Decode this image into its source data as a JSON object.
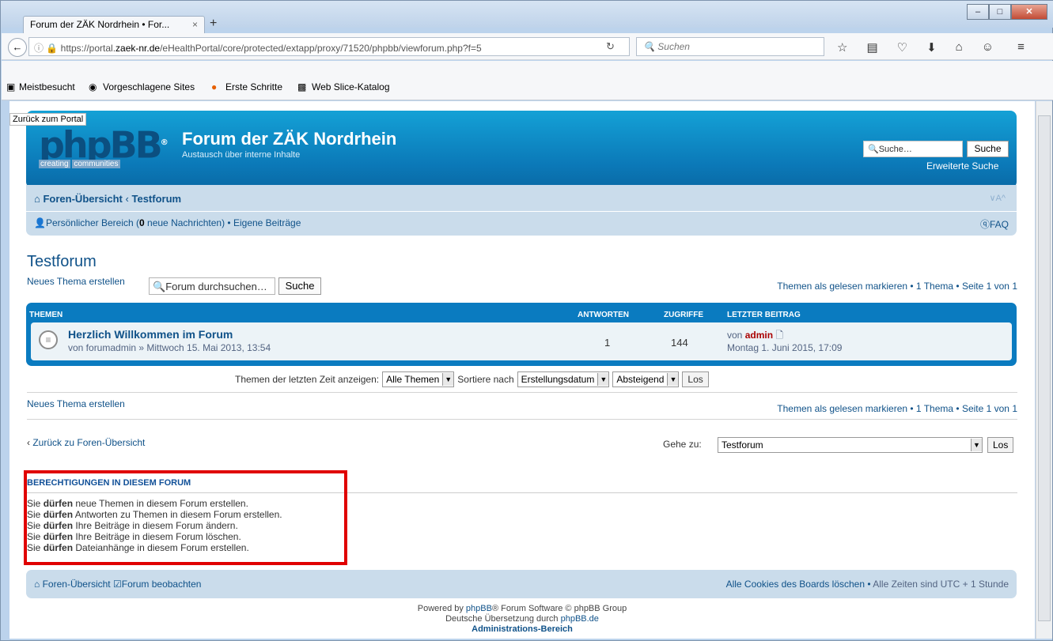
{
  "browser": {
    "tab_title": "Forum der ZÄK Nordrhein • For...",
    "tab_close": "×",
    "new_tab": "+",
    "url_prefix": "https://portal.",
    "url_host": "zaek-nr.de",
    "url_path": "/eHealthPortal/core/protected/extapp/proxy/71520/phpbb/viewforum.php?f=5",
    "search_placeholder": "Suchen",
    "bookmarks": [
      "Meistbesucht",
      "Vorgeschlagene Sites",
      "Erste Schritte",
      "Web Slice-Katalog"
    ]
  },
  "page": {
    "back_to_portal": "Zurück zum Portal",
    "logo_text": "phpBB",
    "logo_sub1": "creating",
    "logo_sub2": "communities",
    "site_name": "Forum der ZÄK Nordrhein",
    "site_desc": "Austausch über interne Inhalte",
    "header_search_value": "Suche…",
    "header_search_button": "Suche",
    "advanced_search": "Erweiterte Suche",
    "crumb_index": "Foren-Übersicht",
    "crumb_sep": "‹",
    "crumb_forum": "Testforum",
    "font_size_ctrl": "∨A^",
    "user_panel_prefix": "Persönlicher Bereich (",
    "new_messages_count": "0",
    "user_panel_suffix": " neue Nachrichten)",
    "own_posts": "Eigene Beiträge",
    "faq": "FAQ",
    "forum_title": "Testforum",
    "new_topic": "Neues Thema erstellen",
    "forum_search_value": "Forum durchsuchen…",
    "forum_search_button": "Suche",
    "mark_read": "Themen als gelesen markieren",
    "topic_count": "1 Thema",
    "page_info": "Seite 1 von 1",
    "col_topics": "Themen",
    "col_replies": "Antworten",
    "col_views": "Zugriffe",
    "col_last": "Letzter Beitrag",
    "topic_title": "Herzlich Willkommen im Forum",
    "topic_by_prefix": "von forumadmin » Mittwoch 15. Mai 2013, 13:54",
    "topic_replies": "1",
    "topic_views": "144",
    "last_by_prefix": "von",
    "last_author": "admin",
    "last_date": "Montag 1. Juni 2015, 17:09",
    "sort_label_time": "Themen der letzten Zeit anzeigen:",
    "sort_time_value": "Alle Themen",
    "sort_label_by": "Sortiere nach",
    "sort_by_value": "Erstellungsdatum",
    "sort_dir_value": "Absteigend",
    "sort_go": "Los",
    "back_to_index": "Zurück zu Foren-Übersicht",
    "jump_label": "Gehe zu:",
    "jump_value": "Testforum",
    "jump_go": "Los",
    "perms_title": "Berechtigungen in diesem Forum",
    "perms_word": "dürfen",
    "perms": [
      {
        "pre": "Sie ",
        "post": " neue Themen in diesem Forum erstellen."
      },
      {
        "pre": "Sie ",
        "post": " Antworten zu Themen in diesem Forum erstellen."
      },
      {
        "pre": "Sie ",
        "post": " Ihre Beiträge in diesem Forum ändern."
      },
      {
        "pre": "Sie ",
        "post": " Ihre Beiträge in diesem Forum löschen."
      },
      {
        "pre": "Sie ",
        "post": " Dateianhänge in diesem Forum erstellen."
      }
    ],
    "footer_index": "Foren-Übersicht",
    "footer_watch": "Forum beobachten",
    "footer_cookies": "Alle Cookies des Boards löschen",
    "footer_tz": "Alle Zeiten sind UTC + 1 Stunde",
    "powered_pre": "Powered by ",
    "powered_link": "phpBB",
    "powered_post": "® Forum Software © phpBB Group",
    "translation_pre": "Deutsche Übersetzung durch ",
    "translation_link": "phpBB.de",
    "admin_link": "Administrations-Bereich"
  }
}
